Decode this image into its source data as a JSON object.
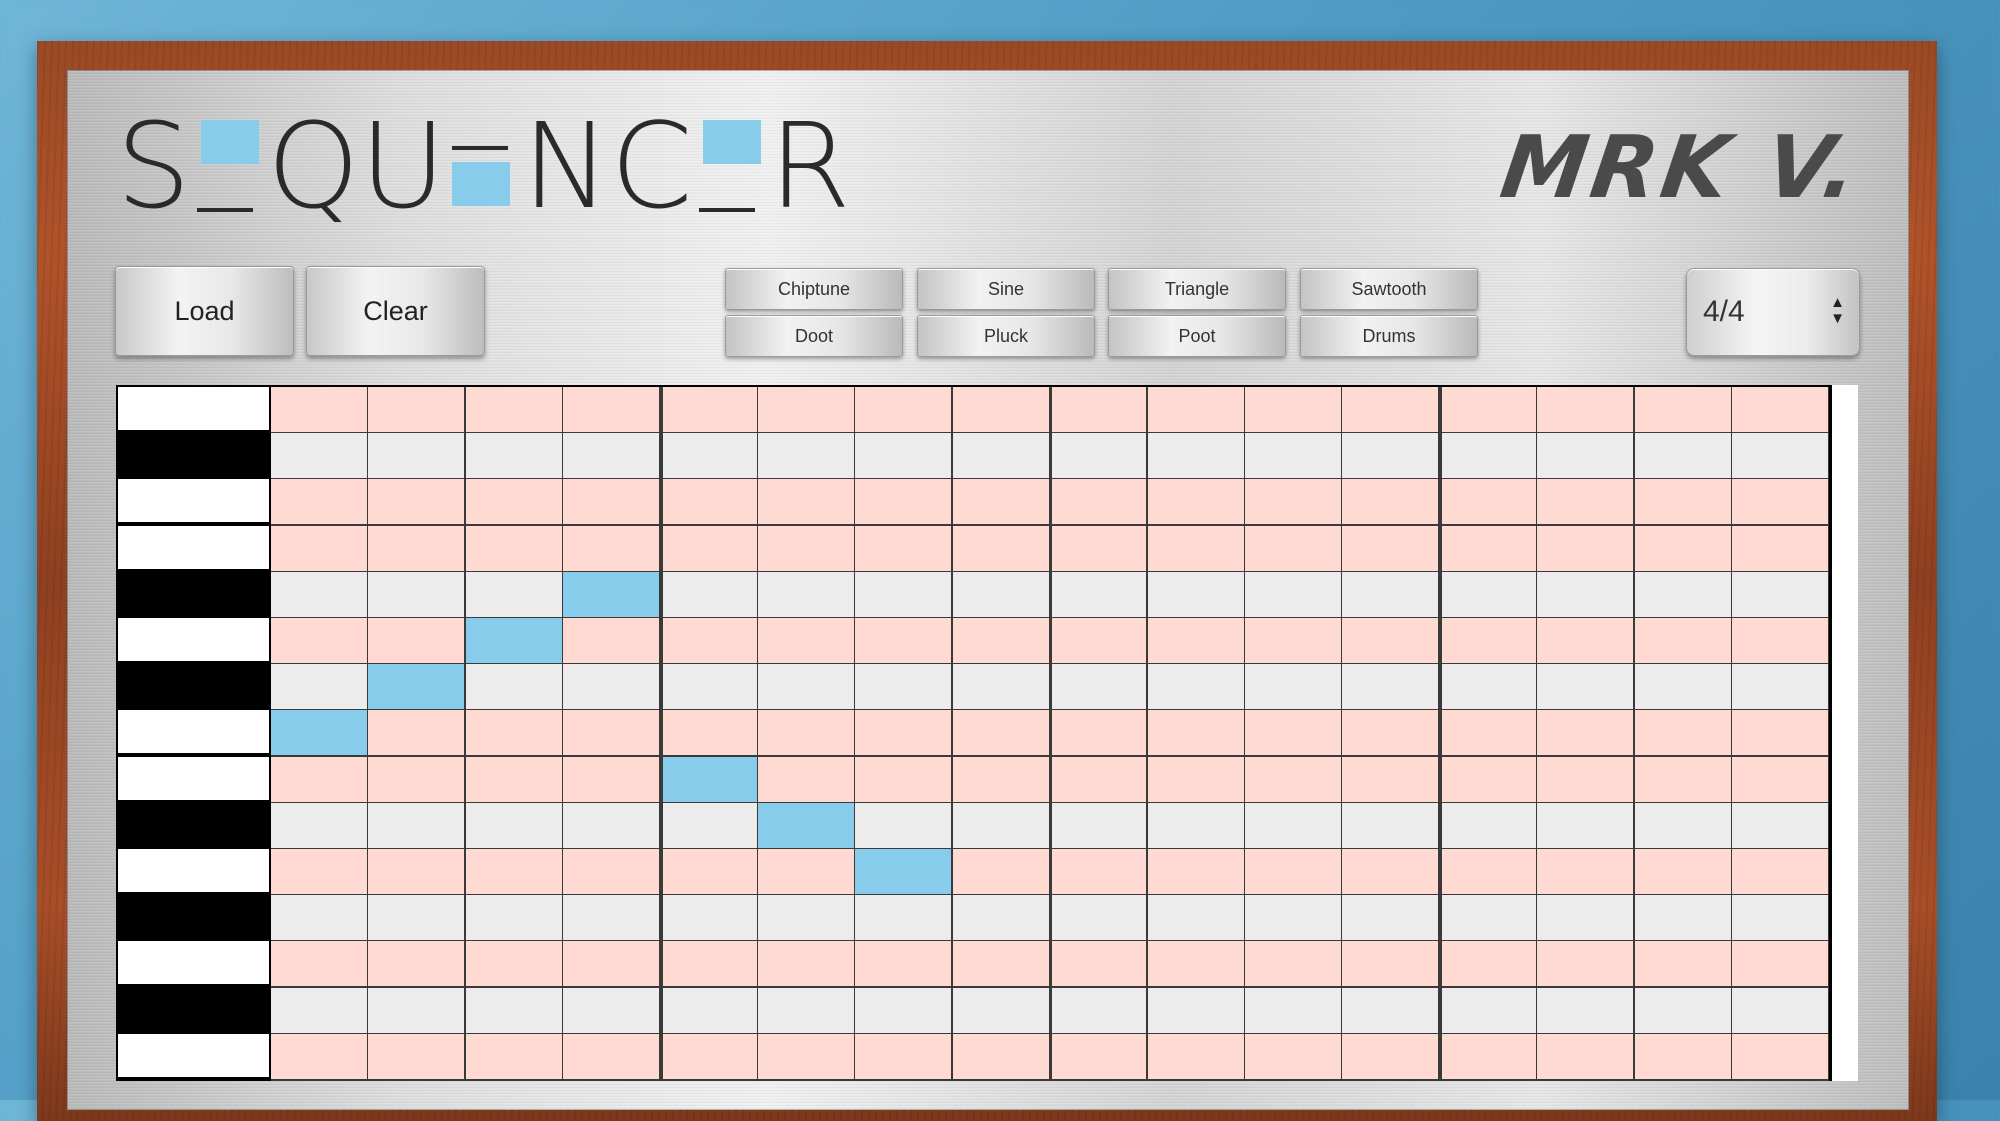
{
  "app": {
    "logo_text": "SEQUENCER",
    "brand": "MRK V."
  },
  "controls": {
    "load_label": "Load",
    "clear_label": "Clear",
    "instruments_top": [
      "Chiptune",
      "Sine",
      "Triangle",
      "Sawtooth"
    ],
    "instruments_bottom": [
      "Doot",
      "Pluck",
      "Poot",
      "Drums"
    ],
    "time_signature": "4/4"
  },
  "grid": {
    "rows": 15,
    "steps": 16,
    "beats_per_measure": 4,
    "row_types": [
      "white",
      "black",
      "white",
      "white",
      "black",
      "white",
      "black",
      "white",
      "white",
      "black",
      "white",
      "black",
      "white",
      "black",
      "white"
    ],
    "active_notes": [
      {
        "step": 1,
        "row": 8
      },
      {
        "step": 2,
        "row": 7
      },
      {
        "step": 3,
        "row": 6
      },
      {
        "step": 4,
        "row": 5
      },
      {
        "step": 5,
        "row": 9
      },
      {
        "step": 6,
        "row": 10
      },
      {
        "step": 7,
        "row": 11
      }
    ]
  },
  "colors": {
    "active_cell": "#88ccec",
    "white_key_row": "#ffdad2",
    "black_key_row": "#ececec",
    "frame": "#a84e28"
  }
}
